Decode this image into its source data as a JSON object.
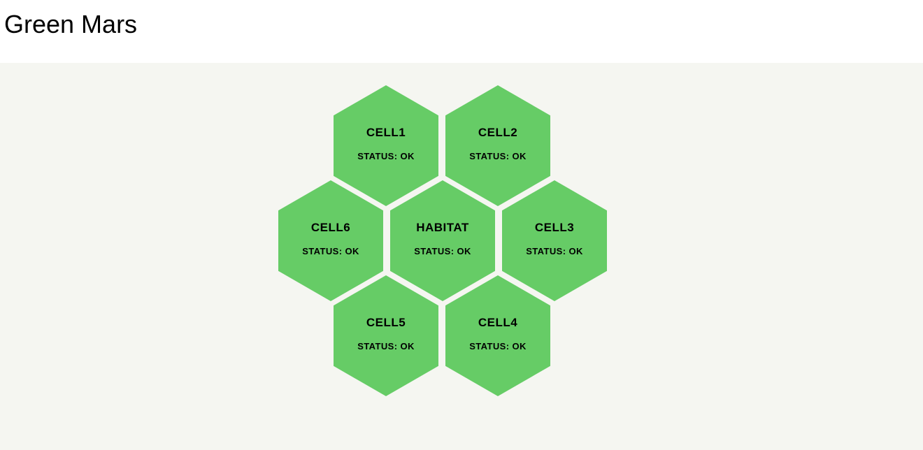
{
  "page": {
    "title": "Green Mars"
  },
  "theme": {
    "hex_color": "#66cc66",
    "background": "#f5f6f1"
  },
  "cells": [
    {
      "name": "CELL1",
      "status": "STATUS: OK"
    },
    {
      "name": "CELL2",
      "status": "STATUS: OK"
    },
    {
      "name": "CELL6",
      "status": "STATUS: OK"
    },
    {
      "name": "HABITAT",
      "status": "STATUS: OK"
    },
    {
      "name": "CELL3",
      "status": "STATUS: OK"
    },
    {
      "name": "CELL5",
      "status": "STATUS: OK"
    },
    {
      "name": "CELL4",
      "status": "STATUS: OK"
    }
  ]
}
